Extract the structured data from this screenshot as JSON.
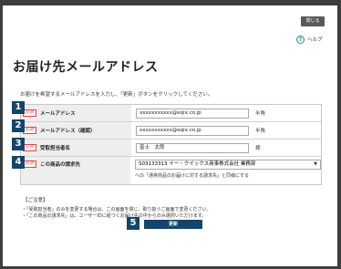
{
  "dialog": {
    "close_label": "閉じる",
    "help_label": "ヘルプ",
    "title": "お届け先メールアドレス",
    "instruction": "お届けを希望するメールアドレスを入力し、「更新」ボタンをクリックしてください。"
  },
  "required_label": "必須",
  "rows": [
    {
      "step": "1",
      "label": "メールアドレス",
      "value": "xxxxxxxxxxx@eqix.co.jp",
      "suffix": "半角"
    },
    {
      "step": "2",
      "label": "メールアドレス（確認）",
      "value": "xxxxxxxxxxx@eqix.co.jp",
      "suffix": "半角"
    },
    {
      "step": "3",
      "label": "受取担当者名",
      "value": "富士　太郎",
      "suffix": "様"
    },
    {
      "step": "4",
      "label": "この商品の請求先",
      "value": "S03133313 イー・クイックス商事株式会社 業務部",
      "note": "への「通常商品のお届けに対する請求先」と同様にする"
    }
  ],
  "notes": {
    "title": "【ご注意】",
    "items": [
      "「受取担当者」のみを変更する場合は、この画面を閉じ、取り扱うご画面で変更ください。",
      "「この商品の請求先」は、ユーザーIDに紐づくお届け先の中からのみ選択いただけます。"
    ]
  },
  "submit": {
    "step": "5",
    "label": "更新"
  },
  "colors": {
    "accent": "#12456d",
    "required": "#e0444c",
    "help": "#0f9e6a"
  }
}
